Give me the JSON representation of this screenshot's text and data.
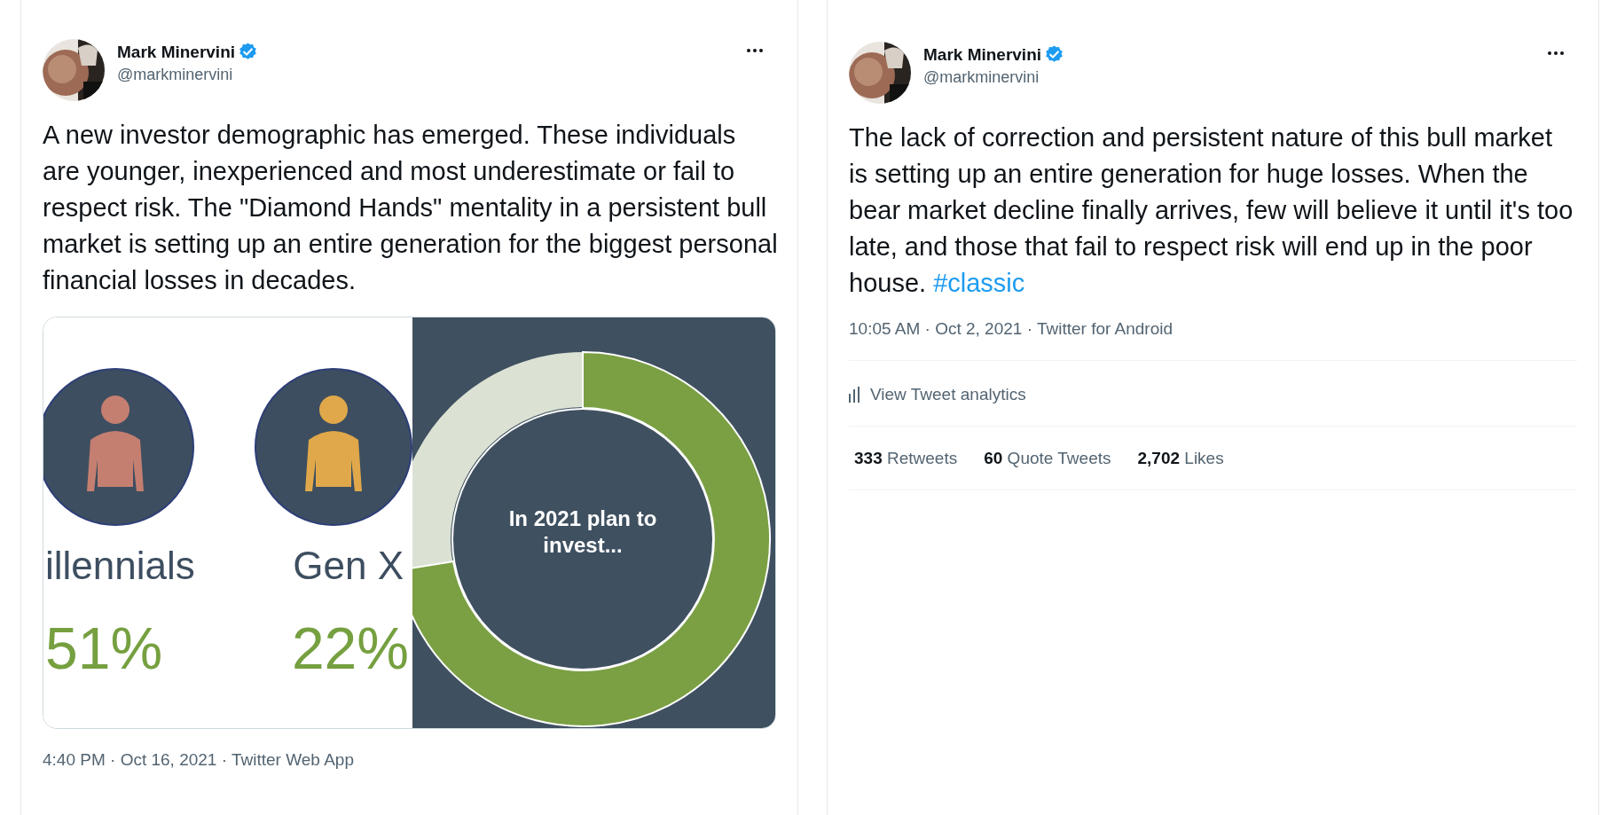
{
  "tweets": [
    {
      "author": {
        "name": "Mark Minervini",
        "handle": "@markminervini",
        "verified": true
      },
      "text": "A new investor demographic has emerged. These individuals are younger, inexperienced and most underestimate or fail to respect risk. The \"Diamond Hands\" mentality in a persistent bull market is setting up an entire generation for the biggest personal financial losses in decades.",
      "media": {
        "kind": "infographic",
        "groups": [
          {
            "label": "illennials",
            "percent": "51%",
            "color": "#c47f70"
          },
          {
            "label": "Gen X",
            "percent": "22%",
            "color": "#e0a84a"
          }
        ],
        "donut_label": "In 2021 plan to invest..."
      },
      "meta": "4:40 PM · Oct 16, 2021 · Twitter Web App"
    },
    {
      "author": {
        "name": "Mark Minervini",
        "handle": "@markminervini",
        "verified": true
      },
      "text": "The lack of correction and persistent nature of this bull market is setting up an entire generation for huge losses. When the bear market decline finally arrives, few will believe it until it's too late, and those that fail to respect risk will end up in the poor house.",
      "hashtag": "#classic",
      "meta": "10:05 AM · Oct 2, 2021 · Twitter for Android",
      "analytics": "View Tweet analytics",
      "stats": [
        {
          "count": "333",
          "label": "Retweets"
        },
        {
          "count": "60",
          "label": "Quote Tweets"
        },
        {
          "count": "2,702",
          "label": "Likes"
        }
      ]
    }
  ]
}
